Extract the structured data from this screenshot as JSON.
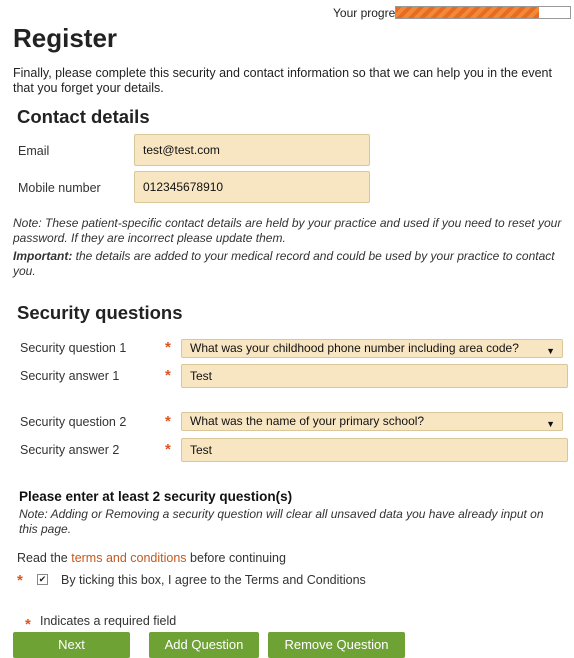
{
  "progress": {
    "label": "Your progress",
    "percent": 0.82
  },
  "page": {
    "title": "Register",
    "intro": "Finally, please complete this security and contact information so that we can help you in the event that you forget your details."
  },
  "contact": {
    "title": "Contact details",
    "email_label": "Email",
    "email_value": "test@test.com",
    "mobile_label": "Mobile number",
    "mobile_value": "012345678910",
    "note": "Note: These patient-specific contact details are held by your practice and used if you need to reset your password. If they are incorrect please update them.",
    "important_strong": "Important:",
    "important_text": " the details are added to your medical record and could be used by your practice to contact you."
  },
  "security": {
    "title": "Security questions",
    "required_mark": "*",
    "q1_label": "Security question 1",
    "q1_value": "What was your childhood phone number including area code?",
    "a1_label": "Security answer 1",
    "a1_value": "Test",
    "q2_label": "Security question 2",
    "q2_value": "What was the name of your primary school?",
    "a2_label": "Security answer 2",
    "a2_value": "Test",
    "caret": "▼"
  },
  "minimum": {
    "heading": "Please enter at least 2 security question(s)",
    "note": "Note: Adding or Removing a security question will clear all unsaved data you have already input on this page."
  },
  "terms": {
    "read_prefix": "Read the ",
    "link_text": "terms and conditions",
    "read_suffix": " before continuing",
    "agree_text": "By ticking this box, I agree to the Terms and Conditions",
    "checked_mark": "✔"
  },
  "footer": {
    "required_legend": "Indicates a required field"
  },
  "buttons": {
    "next": "Next",
    "add": "Add Question",
    "remove": "Remove Question"
  }
}
